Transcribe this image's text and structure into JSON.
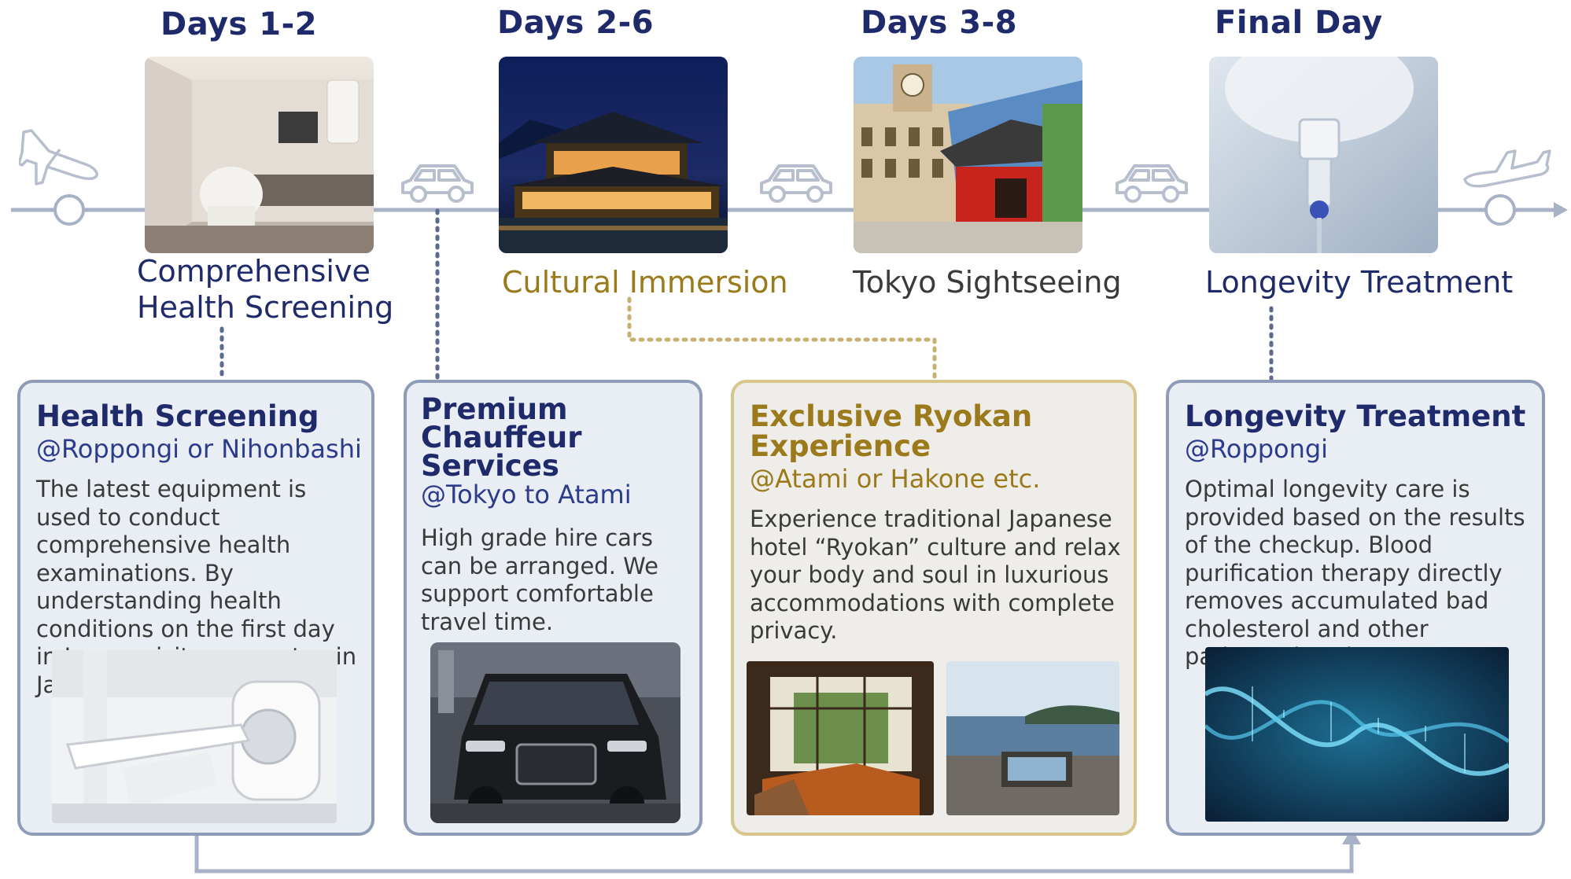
{
  "timeline": {
    "stages": [
      {
        "day": "Days 1-2",
        "title_line1": "Comprehensive",
        "title_line2": "Health Screening",
        "title_color": "#1f2a6b"
      },
      {
        "day": "Days 2-6",
        "title": "Cultural Immersion",
        "title_color": "#9a7a1a"
      },
      {
        "day": "Days 3-8",
        "title": "Tokyo Sightseeing",
        "title_color": "#3a3a3a"
      },
      {
        "day": "Final Day",
        "title": "Longevity Treatment",
        "title_color": "#1f2a6b"
      }
    ]
  },
  "cards": [
    {
      "title": "Health Screening",
      "location": "@Roppongi or Nihonbashi",
      "description": "The latest equipment is used to conduct comprehensive health examinations. By understanding health conditions on the first day in Japan, visitors can stay in Japan with peace of mind."
    },
    {
      "title": "Premium Chauffeur Services",
      "location": "@Tokyo to Atami",
      "description": "High grade hire cars can be arranged. We support comfortable travel time."
    },
    {
      "title": "Exclusive Ryokan Experience",
      "location": "@Atami or Hakone etc.",
      "description": "Experience traditional Japanese hotel “Ryokan” culture and relax your body and soul in luxurious accommodations with complete privacy."
    },
    {
      "title": "Longevity Treatment",
      "location": "@Roppongi",
      "description": "Optimal longevity care is provided based on the results of the checkup. Blood purification therapy directly removes accumulated bad cholesterol and other pathogenic substances."
    }
  ],
  "icons": [
    "airplane-departure-icon",
    "car-icon",
    "airplane-arrival-icon"
  ],
  "colors": {
    "navy": "#1f2a6b",
    "gold": "#9a7a1a",
    "line": "#a8b2c6",
    "card_border": "#8f9cb8"
  }
}
